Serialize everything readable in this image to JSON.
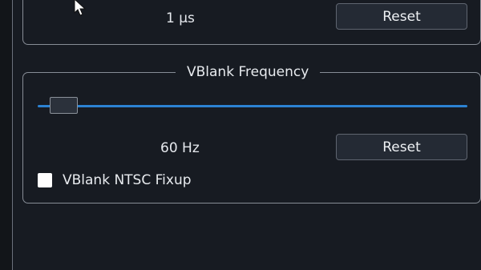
{
  "timing_group": {
    "value": "1 μs",
    "reset_label": "Reset"
  },
  "vblank_group": {
    "title": "VBlank Frequency",
    "slider_value_fraction": 0.03,
    "value": "60 Hz",
    "reset_label": "Reset",
    "ntsc_fixup_label": "VBlank NTSC Fixup",
    "ntsc_fixup_checked": false
  },
  "icons": {
    "cursor": "mouse-pointer-icon"
  },
  "colors": {
    "background": "#171b22",
    "border": "#878d96",
    "slider_accent": "#2c82d2",
    "button_background": "#242a34"
  }
}
